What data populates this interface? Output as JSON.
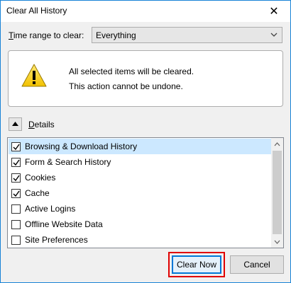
{
  "window": {
    "title": "Clear All History",
    "close_glyph": "✕"
  },
  "range": {
    "label_prefix": "T",
    "label_rest": "ime range to clear:",
    "selected": "Everything"
  },
  "warning": {
    "icon": "warning-triangle-icon",
    "line1": "All selected items will be cleared.",
    "line2": "This action cannot be undone."
  },
  "details": {
    "label_prefix": "D",
    "label_rest": "etails",
    "expanded": true
  },
  "items": [
    {
      "label": "Browsing & Download History",
      "checked": true,
      "selected": true
    },
    {
      "label": "Form & Search History",
      "checked": true,
      "selected": false
    },
    {
      "label": "Cookies",
      "checked": true,
      "selected": false
    },
    {
      "label": "Cache",
      "checked": true,
      "selected": false
    },
    {
      "label": "Active Logins",
      "checked": false,
      "selected": false
    },
    {
      "label": "Offline Website Data",
      "checked": false,
      "selected": false
    },
    {
      "label": "Site Preferences",
      "checked": false,
      "selected": false
    }
  ],
  "buttons": {
    "clear_now": "Clear Now",
    "cancel": "Cancel"
  },
  "colors": {
    "highlight_red": "#e00000",
    "accent_blue": "#0078d7",
    "selection": "#cce8ff"
  }
}
